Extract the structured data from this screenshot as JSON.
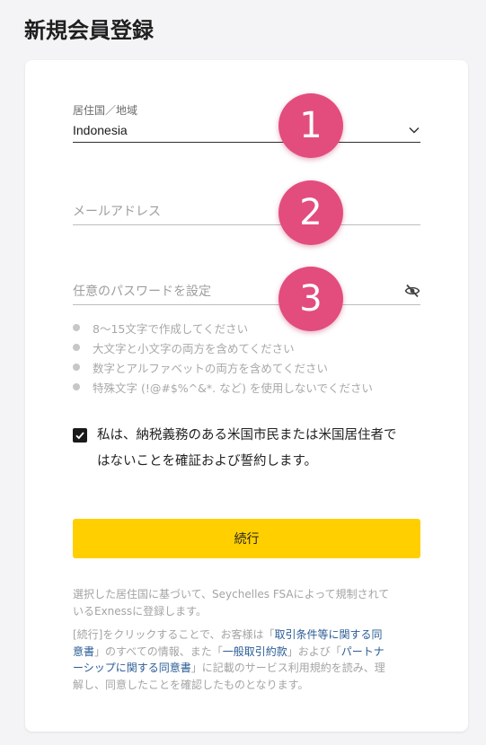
{
  "page": {
    "title": "新規会員登録"
  },
  "form": {
    "country": {
      "label": "居住国／地域",
      "value": "Indonesia"
    },
    "email": {
      "placeholder": "メールアドレス"
    },
    "password": {
      "placeholder": "任意のパスワードを設定"
    },
    "password_rules": [
      "8～15文字で作成してください",
      "大文字と小文字の両方を含めてください",
      "数字とアルファベットの両方を含めてください",
      "特殊文字 (!@#$%^&*. など) を使用しないでください"
    ],
    "consent": {
      "checked": true,
      "text_line1": "私は、納税義務のある米国市民または米国居住者で",
      "text_line2": "はないことを確証および誓約します。"
    },
    "submit_label": "続行"
  },
  "markers": [
    "1",
    "2",
    "3"
  ],
  "footer": {
    "regulation_line1": "選択した居住国に基づいて、Seychelles FSAによって規制されて",
    "regulation_line2": "いるExnessに登録します。",
    "terms": {
      "t1": "[続行]をクリックすることで、お客様は「",
      "link1a": "取引条件等に関する同",
      "link1b": "意書",
      "t2": "」のすべての情報、また「",
      "link2": "一般取引約款",
      "t3": "」および「",
      "link3a": "パートナ",
      "link3b": "ーシップに関する同意書",
      "t4": "」に記載のサービス利用規約を読み、理",
      "t5": "解し、同意したことを確認したものとなります。"
    }
  },
  "colors": {
    "accent": "#ffcf00",
    "marker": "#e24d7d",
    "link": "#2a5c95"
  }
}
